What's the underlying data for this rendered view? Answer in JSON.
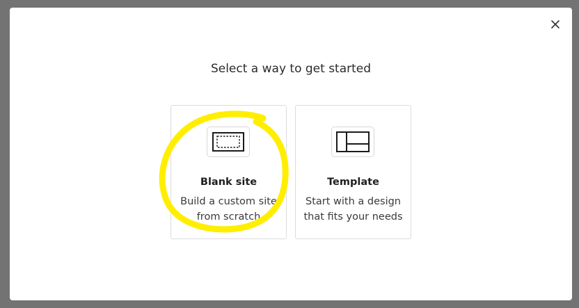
{
  "dialog": {
    "title": "Select a way to get started",
    "close_icon": "close-icon"
  },
  "options": [
    {
      "title": "Blank site",
      "description": "Build a custom site from scratch",
      "icon": "blank-page-icon"
    },
    {
      "title": "Template",
      "description": "Start with a design that fits your needs",
      "icon": "template-layout-icon"
    }
  ],
  "annotation": {
    "color": "#ffee00"
  }
}
